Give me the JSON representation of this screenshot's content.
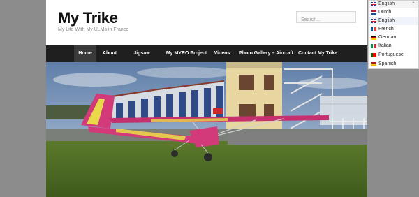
{
  "site": {
    "title": "My Trike",
    "tagline": "My Life With My ULMs in France"
  },
  "search": {
    "placeholder": "Search..."
  },
  "nav": {
    "items": [
      {
        "label": "Home",
        "active": true
      },
      {
        "label": "About"
      },
      {
        "label": "Jigsaw Puzzles"
      },
      {
        "label": "My MYRO Project"
      },
      {
        "label": "Videos"
      },
      {
        "label": "Photo Gallery – Aircraft"
      },
      {
        "label": "Contact My Trike"
      }
    ]
  },
  "language_switcher": {
    "current": "English",
    "options": [
      {
        "label": "Dutch",
        "flag": "nl-flag-icon"
      },
      {
        "label": "English",
        "flag": "gb-flag-icon"
      },
      {
        "label": "French",
        "flag": "fr-flag-icon"
      },
      {
        "label": "German",
        "flag": "de-flag-icon"
      },
      {
        "label": "Italian",
        "flag": "it-flag-icon"
      },
      {
        "label": "Portuguese",
        "flag": "pt-flag-icon"
      },
      {
        "label": "Spanish",
        "flag": "es-flag-icon"
      }
    ],
    "chevron_icon": "chevron-up-icon"
  },
  "colors": {
    "nav_bg": "#1f1f1f",
    "nav_active_bg": "#3a3a3a",
    "page_bg": "#8c8c8c",
    "aircraft_wing": "#d23a7a",
    "aircraft_stripe": "#e8d84a"
  }
}
